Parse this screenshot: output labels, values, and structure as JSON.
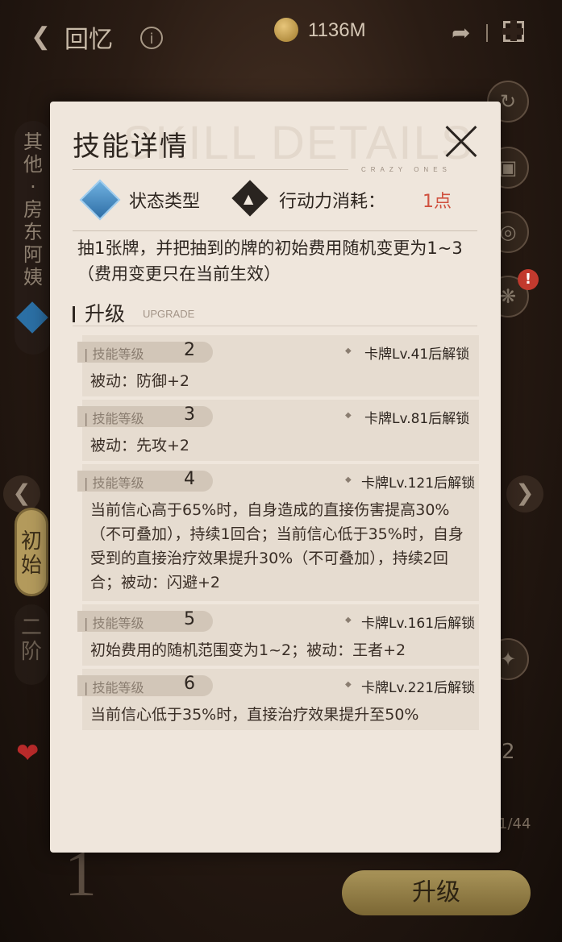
{
  "topbar": {
    "back_label": "回忆",
    "info_icon": "info-icon",
    "currency_amount": "1136M"
  },
  "left_sidebar": {
    "character_text": "其他·房东阿姨",
    "tier_selected": "初始",
    "tier_next": "二阶"
  },
  "right_sidebar": {
    "alert_badge": "!",
    "count_value": "2",
    "page_count": "1/44"
  },
  "footer": {
    "upgrade_button": "升级"
  },
  "modal": {
    "title": "技能详情",
    "bg_word": "SKILL DETAILS",
    "brand": "CRAZY ONES",
    "state_label": "状态类型",
    "ap_label": "行动力消耗：",
    "ap_value": "1点",
    "description": "抽1张牌，并把抽到的牌的初始费用随机变更为1~3（费用变更只在当前生效）",
    "upgrade_heading": "升级",
    "upgrade_sub": "UPGRADE",
    "levels": [
      {
        "tag": "| 技能等级",
        "level": "2",
        "unlock": "卡牌Lv.41后解锁",
        "text": "被动：防御+2"
      },
      {
        "tag": "| 技能等级",
        "level": "3",
        "unlock": "卡牌Lv.81后解锁",
        "text": "被动：先攻+2"
      },
      {
        "tag": "| 技能等级",
        "level": "4",
        "unlock": "卡牌Lv.121后解锁",
        "text": "当前信心高于65%时，自身造成的直接伤害提高30%（不可叠加），持续1回合；当前信心低于35%时，自身受到的直接治疗效果提升30%（不可叠加），持续2回合；被动：闪避+2"
      },
      {
        "tag": "| 技能等级",
        "level": "5",
        "unlock": "卡牌Lv.161后解锁",
        "text": "初始费用的随机范围变为1~2；被动：王者+2"
      },
      {
        "tag": "| 技能等级",
        "level": "6",
        "unlock": "卡牌Lv.221后解锁",
        "text": "当前信心低于35%时，直接治疗效果提升至50%"
      }
    ]
  }
}
